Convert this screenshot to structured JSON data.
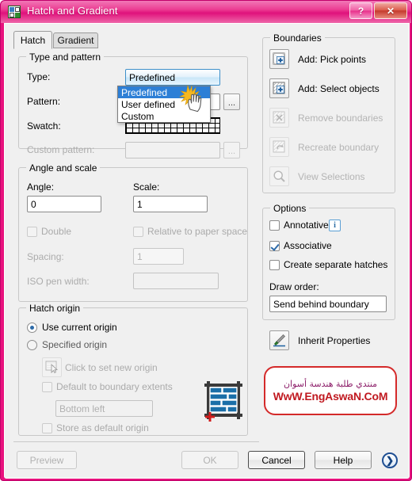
{
  "window": {
    "title": "Hatch and Gradient",
    "icon": "hatch-gradient-app-icon",
    "help_button": "?",
    "close_button": "✕",
    "accent_color": "#e8127e",
    "close_color": "#c3372a"
  },
  "tabs": [
    {
      "label": "Hatch",
      "active": true
    },
    {
      "label": "Gradient",
      "active": false
    }
  ],
  "type_and_pattern": {
    "group_label": "Type and pattern",
    "type_label": "Type:",
    "type_value": "Predefined",
    "type_options": [
      "Predefined",
      "User defined",
      "Custom"
    ],
    "type_selected_index": 0,
    "pattern_label": "Pattern:",
    "pattern_value": "",
    "pattern_browse": "...",
    "swatch_label": "Swatch:",
    "custom_pattern_label": "Custom pattern:",
    "custom_pattern_value": "",
    "custom_pattern_browse": "...",
    "custom_pattern_enabled": false
  },
  "angle_and_scale": {
    "group_label": "Angle and scale",
    "angle_label": "Angle:",
    "angle_value": "0",
    "scale_label": "Scale:",
    "scale_value": "1",
    "double_label": "Double",
    "double_checked": false,
    "double_enabled": false,
    "relative_label": "Relative to paper space",
    "relative_checked": false,
    "relative_enabled": false,
    "spacing_label": "Spacing:",
    "spacing_value": "1",
    "spacing_enabled": false,
    "iso_pen_width_label": "ISO pen width:",
    "iso_pen_width_value": "",
    "iso_pen_width_enabled": false
  },
  "hatch_origin": {
    "group_label": "Hatch origin",
    "use_current_label": "Use current origin",
    "use_current_selected": true,
    "specified_label": "Specified origin",
    "specified_selected": false,
    "click_set_label": "Click to set new origin",
    "click_set_enabled": false,
    "default_extents_label": "Default to boundary extents",
    "default_extents_checked": false,
    "extents_corner_value": "Bottom left",
    "extents_corner_enabled": false,
    "store_default_label": "Store as default origin",
    "store_default_checked": false,
    "preview_icon": "brick-origin-preview-icon"
  },
  "boundaries": {
    "group_label": "Boundaries",
    "items": [
      {
        "label": "Add: Pick points",
        "icon": "pick-points-icon",
        "enabled": true
      },
      {
        "label": "Add: Select objects",
        "icon": "select-objects-icon",
        "enabled": true
      },
      {
        "label": "Remove boundaries",
        "icon": "remove-boundaries-icon",
        "enabled": false
      },
      {
        "label": "Recreate boundary",
        "icon": "recreate-boundary-icon",
        "enabled": false
      },
      {
        "label": "View Selections",
        "icon": "view-selections-icon",
        "enabled": false
      }
    ]
  },
  "options": {
    "group_label": "Options",
    "annotative_label": "Annotative",
    "annotative_checked": false,
    "annotative_info": "i",
    "associative_label": "Associative",
    "associative_checked": true,
    "separate_hatches_label": "Create separate hatches",
    "separate_hatches_checked": false,
    "draw_order_label": "Draw order:",
    "draw_order_value": "Send behind boundary",
    "inherit_properties_label": "Inherit Properties",
    "inherit_properties_icon": "inherit-properties-brush-icon"
  },
  "watermark": {
    "arabic": "منتدي طلبة هندسة أسوان",
    "url": "WwW.EngAswaN.CoM",
    "border_color": "#d42a2a",
    "url_color": "#c0181f"
  },
  "footer": {
    "preview_label": "Preview",
    "preview_enabled": false,
    "ok_label": "OK",
    "ok_enabled": false,
    "cancel_label": "Cancel",
    "cancel_enabled": true,
    "help_label": "Help",
    "help_enabled": true,
    "expand_label": "❯",
    "expand_icon": "expand-arrow-icon"
  },
  "cursor": {
    "icon": "hand-pointer-click-icon"
  }
}
